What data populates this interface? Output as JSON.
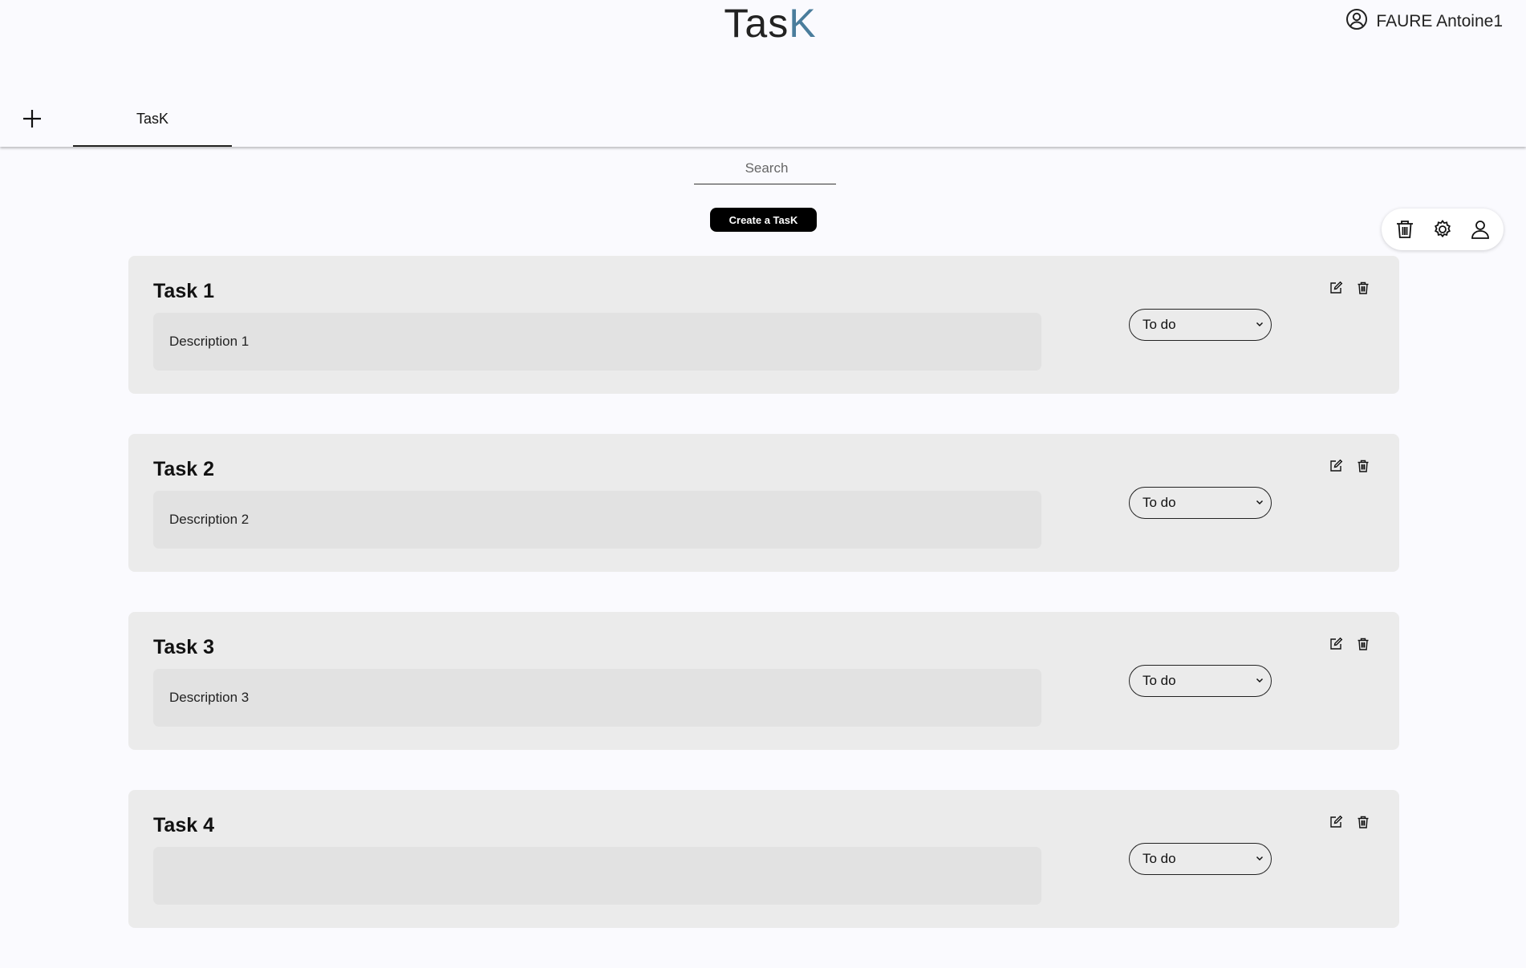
{
  "header": {
    "title_main": "Tas",
    "title_accent": "K",
    "user_name": "FAURE Antoine1"
  },
  "tabs": [
    {
      "label": "TasK"
    }
  ],
  "search": {
    "placeholder": "Search",
    "value": ""
  },
  "create_button_label": "Create a TasK",
  "toolbar": {
    "icons": [
      "trash-icon",
      "gear-icon",
      "user-icon"
    ]
  },
  "tasks": [
    {
      "title": "Task 1",
      "description": "Description 1",
      "status": "To do"
    },
    {
      "title": "Task 2",
      "description": "Description 2",
      "status": "To do"
    },
    {
      "title": "Task 3",
      "description": "Description 3",
      "status": "To do"
    },
    {
      "title": "Task 4",
      "description": "",
      "status": "To do"
    }
  ],
  "colors": {
    "title_accent": "#4a7d9c",
    "card_bg": "#ebebeb",
    "description_bg": "#e2e2e2",
    "page_bg": "#fafafe",
    "button_bg": "#000000"
  }
}
